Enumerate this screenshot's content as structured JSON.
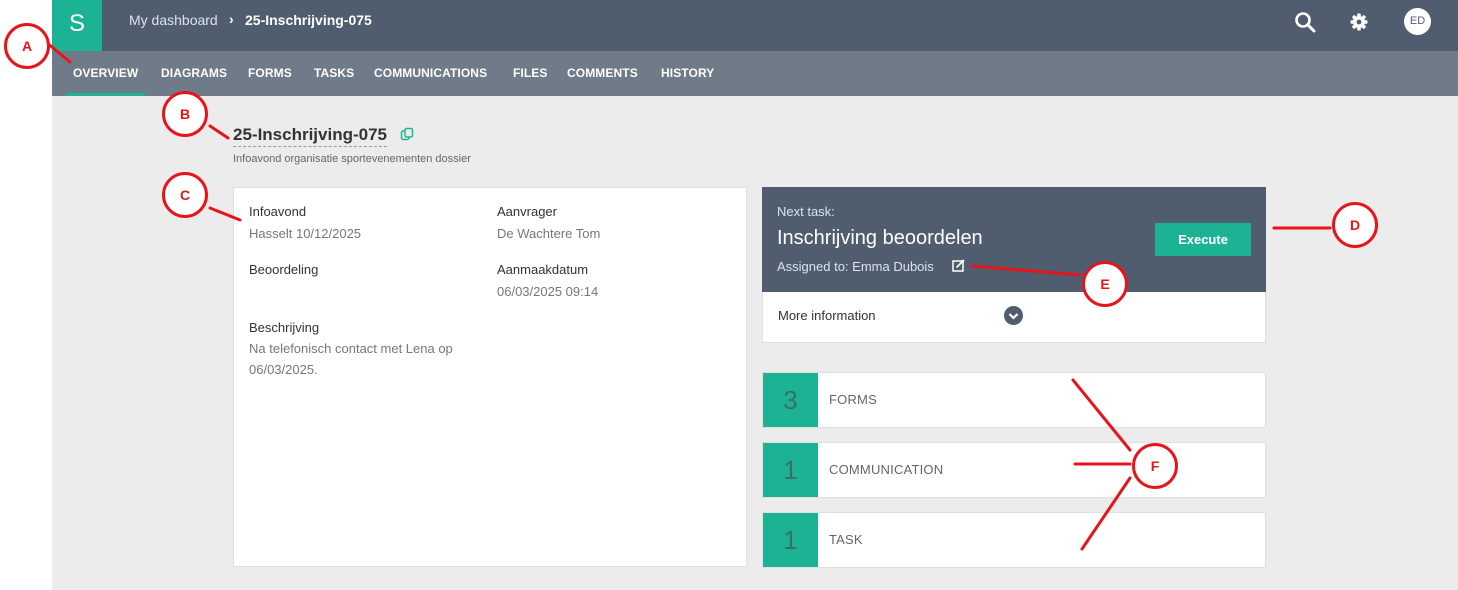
{
  "logo": "S",
  "breadcrumb": {
    "dashboard": "My dashboard",
    "separator": "›",
    "current": "25-Inschrijving-075"
  },
  "topbar": {
    "avatar_initials": "ED",
    "icons": [
      "search-icon",
      "gear-icon"
    ]
  },
  "tabs": [
    "OVERVIEW",
    "DIAGRAMS",
    "FORMS",
    "TASKS",
    "COMMUNICATIONS",
    "FILES",
    "COMMENTS",
    "HISTORY"
  ],
  "case": {
    "title": "25-Inschrijving-075",
    "subtitle": "Infoavond organisatie sportevenementen dossier"
  },
  "details": {
    "infoavond_label": "Infoavond",
    "infoavond_value": "Hasselt 10/12/2025",
    "aanvrager_label": "Aanvrager",
    "aanvrager_value": "De Wachtere Tom",
    "beoordeling_label": "Beoordeling",
    "aanmaakdatum_label": "Aanmaakdatum",
    "aanmaakdatum_value": "06/03/2025 09:14",
    "beschrijving_label": "Beschrijving",
    "beschrijving_line1": "Na telefonisch contact met Lena op",
    "beschrijving_line2": "06/03/2025."
  },
  "next_task": {
    "prefix": "Next task:",
    "name": "Inschrijving beoordelen",
    "assigned": "Assigned to: Emma Dubois",
    "execute_label": "Execute",
    "more_info": "More information"
  },
  "counters": [
    {
      "count": "3",
      "label": "FORMS"
    },
    {
      "count": "1",
      "label": "COMMUNICATION"
    },
    {
      "count": "1",
      "label": "TASK"
    }
  ],
  "annotations": {
    "a": "A",
    "b": "B",
    "c": "C",
    "d": "D",
    "e": "E",
    "f": "F"
  },
  "colors": {
    "accent": "#1bb394",
    "topbar": "#4f5d6f",
    "tabbar": "#6f7b89",
    "annotation": "#e8141b"
  }
}
